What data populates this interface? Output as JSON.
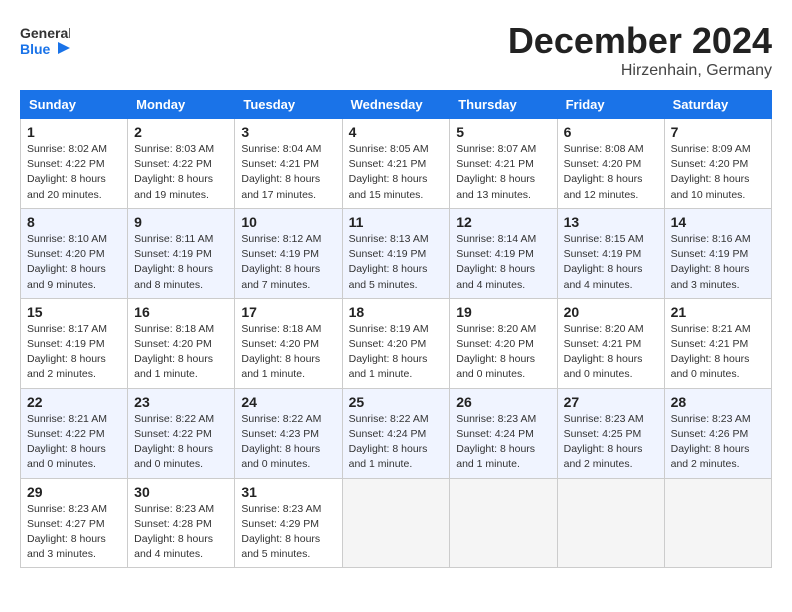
{
  "header": {
    "logo_line1": "General",
    "logo_line2": "Blue",
    "month": "December 2024",
    "location": "Hirzenhain, Germany"
  },
  "weekdays": [
    "Sunday",
    "Monday",
    "Tuesday",
    "Wednesday",
    "Thursday",
    "Friday",
    "Saturday"
  ],
  "weeks": [
    [
      {
        "day": "1",
        "info": "Sunrise: 8:02 AM\nSunset: 4:22 PM\nDaylight: 8 hours\nand 20 minutes."
      },
      {
        "day": "2",
        "info": "Sunrise: 8:03 AM\nSunset: 4:22 PM\nDaylight: 8 hours\nand 19 minutes."
      },
      {
        "day": "3",
        "info": "Sunrise: 8:04 AM\nSunset: 4:21 PM\nDaylight: 8 hours\nand 17 minutes."
      },
      {
        "day": "4",
        "info": "Sunrise: 8:05 AM\nSunset: 4:21 PM\nDaylight: 8 hours\nand 15 minutes."
      },
      {
        "day": "5",
        "info": "Sunrise: 8:07 AM\nSunset: 4:21 PM\nDaylight: 8 hours\nand 13 minutes."
      },
      {
        "day": "6",
        "info": "Sunrise: 8:08 AM\nSunset: 4:20 PM\nDaylight: 8 hours\nand 12 minutes."
      },
      {
        "day": "7",
        "info": "Sunrise: 8:09 AM\nSunset: 4:20 PM\nDaylight: 8 hours\nand 10 minutes."
      }
    ],
    [
      {
        "day": "8",
        "info": "Sunrise: 8:10 AM\nSunset: 4:20 PM\nDaylight: 8 hours\nand 9 minutes."
      },
      {
        "day": "9",
        "info": "Sunrise: 8:11 AM\nSunset: 4:19 PM\nDaylight: 8 hours\nand 8 minutes."
      },
      {
        "day": "10",
        "info": "Sunrise: 8:12 AM\nSunset: 4:19 PM\nDaylight: 8 hours\nand 7 minutes."
      },
      {
        "day": "11",
        "info": "Sunrise: 8:13 AM\nSunset: 4:19 PM\nDaylight: 8 hours\nand 5 minutes."
      },
      {
        "day": "12",
        "info": "Sunrise: 8:14 AM\nSunset: 4:19 PM\nDaylight: 8 hours\nand 4 minutes."
      },
      {
        "day": "13",
        "info": "Sunrise: 8:15 AM\nSunset: 4:19 PM\nDaylight: 8 hours\nand 4 minutes."
      },
      {
        "day": "14",
        "info": "Sunrise: 8:16 AM\nSunset: 4:19 PM\nDaylight: 8 hours\nand 3 minutes."
      }
    ],
    [
      {
        "day": "15",
        "info": "Sunrise: 8:17 AM\nSunset: 4:19 PM\nDaylight: 8 hours\nand 2 minutes."
      },
      {
        "day": "16",
        "info": "Sunrise: 8:18 AM\nSunset: 4:20 PM\nDaylight: 8 hours\nand 1 minute."
      },
      {
        "day": "17",
        "info": "Sunrise: 8:18 AM\nSunset: 4:20 PM\nDaylight: 8 hours\nand 1 minute."
      },
      {
        "day": "18",
        "info": "Sunrise: 8:19 AM\nSunset: 4:20 PM\nDaylight: 8 hours\nand 1 minute."
      },
      {
        "day": "19",
        "info": "Sunrise: 8:20 AM\nSunset: 4:20 PM\nDaylight: 8 hours\nand 0 minutes."
      },
      {
        "day": "20",
        "info": "Sunrise: 8:20 AM\nSunset: 4:21 PM\nDaylight: 8 hours\nand 0 minutes."
      },
      {
        "day": "21",
        "info": "Sunrise: 8:21 AM\nSunset: 4:21 PM\nDaylight: 8 hours\nand 0 minutes."
      }
    ],
    [
      {
        "day": "22",
        "info": "Sunrise: 8:21 AM\nSunset: 4:22 PM\nDaylight: 8 hours\nand 0 minutes."
      },
      {
        "day": "23",
        "info": "Sunrise: 8:22 AM\nSunset: 4:22 PM\nDaylight: 8 hours\nand 0 minutes."
      },
      {
        "day": "24",
        "info": "Sunrise: 8:22 AM\nSunset: 4:23 PM\nDaylight: 8 hours\nand 0 minutes."
      },
      {
        "day": "25",
        "info": "Sunrise: 8:22 AM\nSunset: 4:24 PM\nDaylight: 8 hours\nand 1 minute."
      },
      {
        "day": "26",
        "info": "Sunrise: 8:23 AM\nSunset: 4:24 PM\nDaylight: 8 hours\nand 1 minute."
      },
      {
        "day": "27",
        "info": "Sunrise: 8:23 AM\nSunset: 4:25 PM\nDaylight: 8 hours\nand 2 minutes."
      },
      {
        "day": "28",
        "info": "Sunrise: 8:23 AM\nSunset: 4:26 PM\nDaylight: 8 hours\nand 2 minutes."
      }
    ],
    [
      {
        "day": "29",
        "info": "Sunrise: 8:23 AM\nSunset: 4:27 PM\nDaylight: 8 hours\nand 3 minutes."
      },
      {
        "day": "30",
        "info": "Sunrise: 8:23 AM\nSunset: 4:28 PM\nDaylight: 8 hours\nand 4 minutes."
      },
      {
        "day": "31",
        "info": "Sunrise: 8:23 AM\nSunset: 4:29 PM\nDaylight: 8 hours\nand 5 minutes."
      },
      null,
      null,
      null,
      null
    ]
  ]
}
